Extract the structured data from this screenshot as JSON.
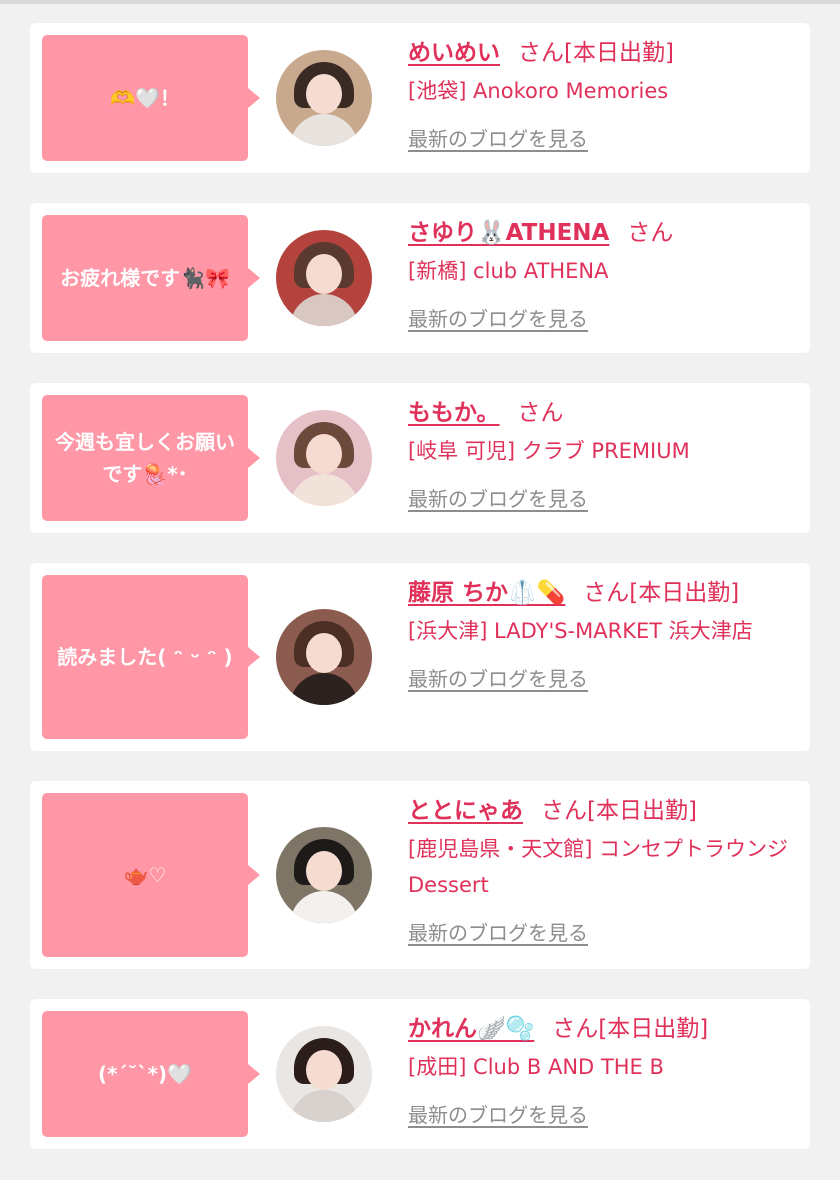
{
  "entries": [
    {
      "message": "🫶🤍！",
      "name": "めいめい",
      "honorific": "さん",
      "status": "[本日出勤]",
      "shop": "[池袋] Anokoro Memories",
      "blog_link": "最新のブログを見る",
      "avatar_colors": {
        "bg": "#c9a98e",
        "hair": "#3a2a24",
        "body": "#e8e3df"
      }
    },
    {
      "message": "お疲れ様です🐈‍⬛🎀",
      "name": "さゆり🐰ATHENA",
      "honorific": "さん",
      "status": "",
      "shop": "[新橋] club ATHENA",
      "blog_link": "最新のブログを見る",
      "avatar_colors": {
        "bg": "#b5433d",
        "hair": "#5a3a30",
        "body": "#d9c7c2"
      }
    },
    {
      "message": "今週も宜しくお願いです🪼*･",
      "name": "ももか。",
      "honorific": "さん",
      "status": "",
      "shop": "[岐阜 可児] クラブ PREMIUM",
      "blog_link": "最新のブログを見る",
      "avatar_colors": {
        "bg": "#e6c0c7",
        "hair": "#6b4a3b",
        "body": "#f1e2da"
      }
    },
    {
      "message": "読みました( ᵔ ᵕ ᵔ )",
      "name": "藤原 ちか🥼💊",
      "honorific": "さん",
      "status": "[本日出勤]",
      "shop": "[浜大津] LADY'S-MARKET 浜大津店",
      "blog_link": "最新のブログを見る",
      "avatar_colors": {
        "bg": "#8a5b4e",
        "hair": "#4b2f25",
        "body": "#2c2321"
      }
    },
    {
      "message": "🫖♡",
      "name": "ととにゃあ",
      "honorific": "さん",
      "status": "[本日出勤]",
      "shop": "[鹿児島県・天文館] コンセプトラウンジ Dessert",
      "blog_link": "最新のブログを見る",
      "avatar_colors": {
        "bg": "#7f7566",
        "hair": "#1d1a1a",
        "body": "#f3f0ee"
      }
    },
    {
      "message": "(*ˊ˘ˋ*)🤍",
      "name": "かれん🪽🫧",
      "honorific": "さん",
      "status": "[本日出勤]",
      "shop": "[成田] Club B AND THE B",
      "blog_link": "最新のブログを見る",
      "avatar_colors": {
        "bg": "#e9e6e3",
        "hair": "#2a1d1a",
        "body": "#d8d2cf"
      }
    }
  ]
}
